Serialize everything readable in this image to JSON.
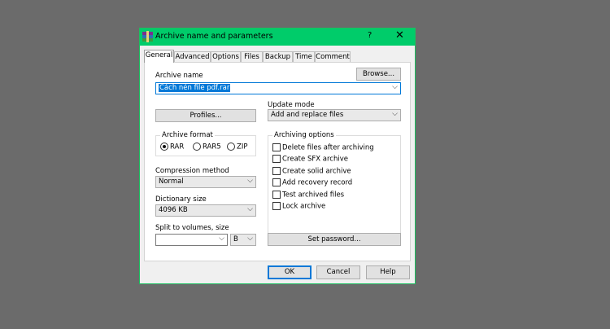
{
  "window": {
    "title": "Archive name and parameters",
    "help": "?",
    "close": "✕"
  },
  "tabs": [
    {
      "label": "General"
    },
    {
      "label": "Advanced"
    },
    {
      "label": "Options"
    },
    {
      "label": "Files"
    },
    {
      "label": "Backup"
    },
    {
      "label": "Time"
    },
    {
      "label": "Comment"
    }
  ],
  "archive_name": {
    "label": "Archive name",
    "value": "Cách nén file pdf.rar",
    "browse": "Browse..."
  },
  "profiles": {
    "label": "Profiles..."
  },
  "update_mode": {
    "label": "Update mode",
    "value": "Add and replace files"
  },
  "archive_format": {
    "label": "Archive format",
    "options": [
      {
        "label": "RAR",
        "selected": true
      },
      {
        "label": "RAR5",
        "selected": false
      },
      {
        "label": "ZIP",
        "selected": false
      }
    ]
  },
  "compression_method": {
    "label": "Compression method",
    "value": "Normal"
  },
  "dictionary_size": {
    "label": "Dictionary size",
    "value": "4096 KB"
  },
  "split": {
    "label": "Split to volumes, size",
    "value": "",
    "unit": "B"
  },
  "archiving_options": {
    "label": "Archiving options",
    "items": [
      {
        "label": "Delete files after archiving",
        "checked": false
      },
      {
        "label": "Create SFX archive",
        "checked": false
      },
      {
        "label": "Create solid archive",
        "checked": false
      },
      {
        "label": "Add recovery record",
        "checked": false
      },
      {
        "label": "Test archived files",
        "checked": false
      },
      {
        "label": "Lock archive",
        "checked": false
      }
    ]
  },
  "set_password": {
    "label": "Set password..."
  },
  "footer": {
    "ok": "OK",
    "cancel": "Cancel",
    "help": "Help"
  },
  "icons": {
    "dropdown": "chevron-down-icon",
    "app": "winrar-books-icon"
  }
}
